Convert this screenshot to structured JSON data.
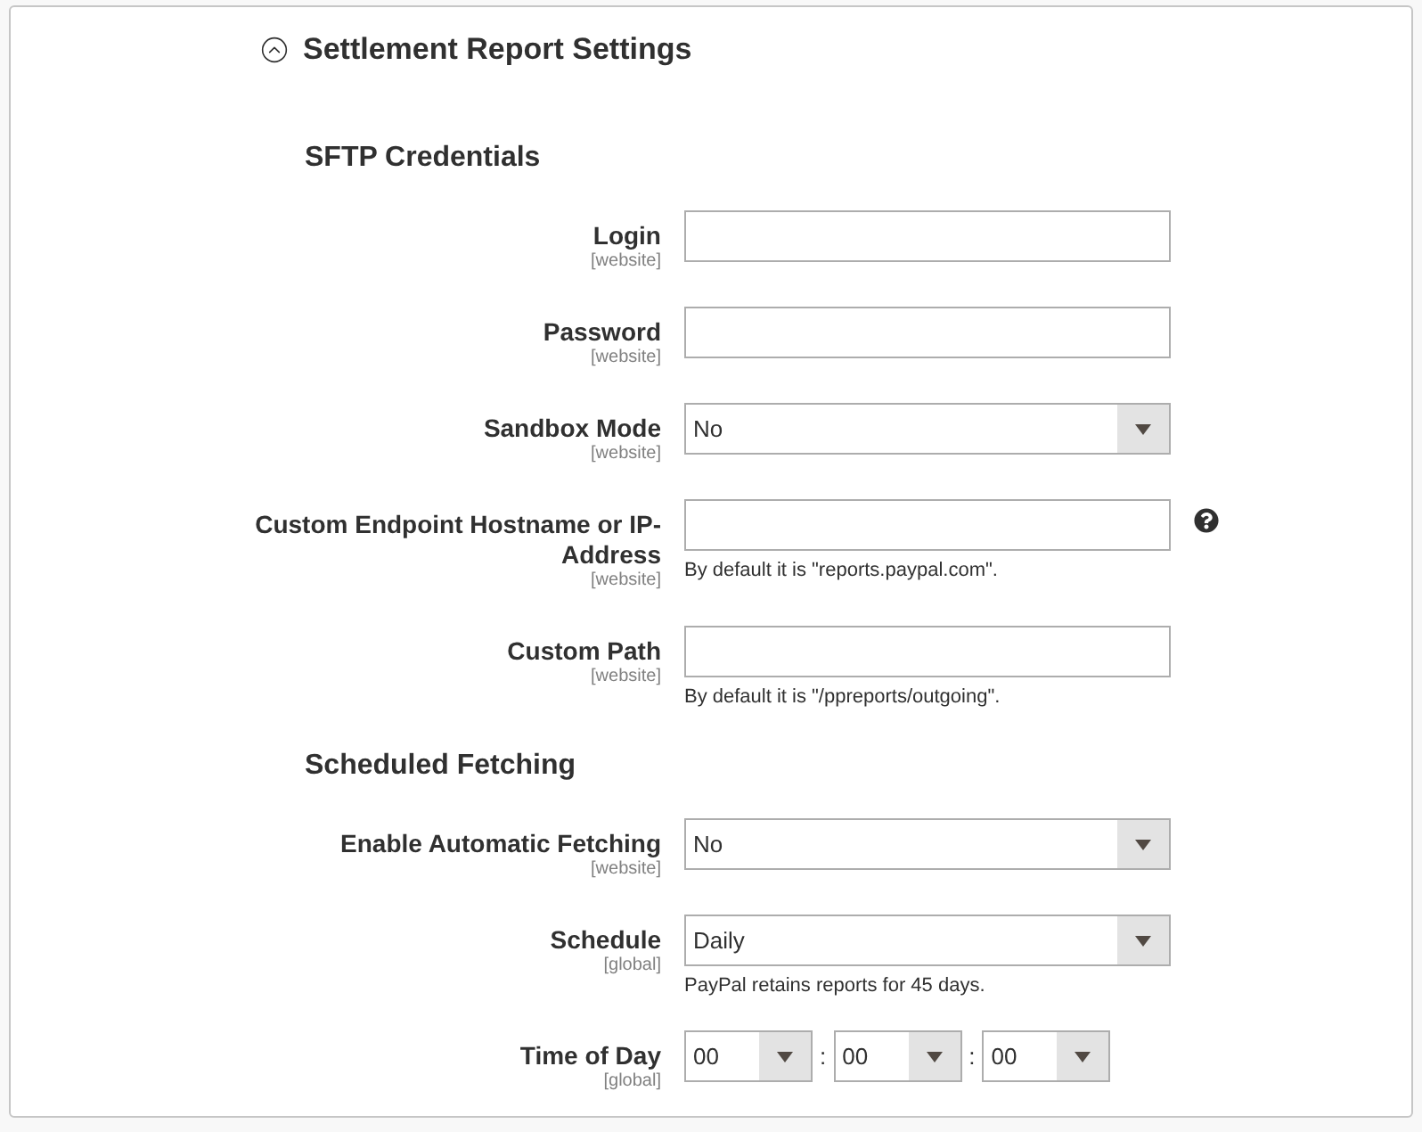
{
  "section": {
    "title": "Settlement Report Settings",
    "expanded": true
  },
  "groups": [
    {
      "heading": "SFTP Credentials",
      "rows": [
        {
          "kind": "text",
          "label": "Login",
          "scope": "[website]"
        },
        {
          "kind": "text",
          "label": "Password",
          "scope": "[website]"
        },
        {
          "kind": "select",
          "label": "Sandbox Mode",
          "scope": "[website]",
          "value": "No"
        },
        {
          "kind": "text",
          "label": "Custom Endpoint Hostname or IP-Address",
          "scope": "[website]",
          "note": "By default it is \"reports.paypal.com\".",
          "help": true
        },
        {
          "kind": "text",
          "label": "Custom Path",
          "scope": "[website]",
          "note": "By default it is \"/ppreports/outgoing\"."
        }
      ]
    },
    {
      "heading": "Scheduled Fetching",
      "rows": [
        {
          "kind": "select",
          "label": "Enable Automatic Fetching",
          "scope": "[website]",
          "value": "No"
        },
        {
          "kind": "select",
          "label": "Schedule",
          "scope": "[global]",
          "value": "Daily",
          "note": "PayPal retains reports for 45 days."
        },
        {
          "kind": "time",
          "label": "Time of Day",
          "scope": "[global]",
          "parts": [
            "00",
            "00",
            "00"
          ],
          "separators": [
            ":",
            ":"
          ]
        }
      ]
    }
  ]
}
